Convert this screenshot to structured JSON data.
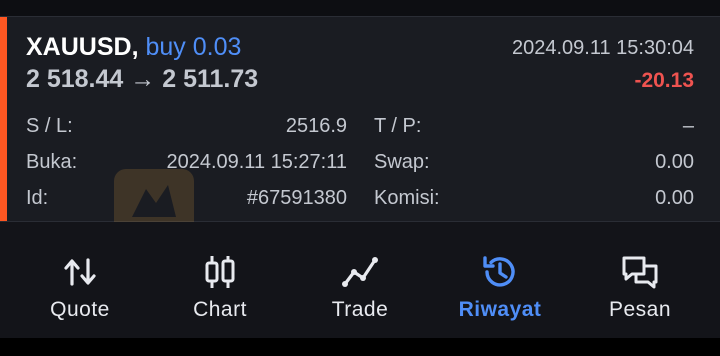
{
  "position": {
    "symbol": "XAUUSD,",
    "side_volume": "buy 0.03",
    "open_price": "2 518.44",
    "arrow": "→",
    "current_price": "2 511.73",
    "time": "2024.09.11 15:30:04",
    "profit": "-20.13",
    "profit_color": "#ef5350",
    "accent_color": "#ff5722"
  },
  "details": {
    "sl_label": "S / L:",
    "sl_value": "2516.9",
    "tp_label": "T / P:",
    "tp_value": "–",
    "open_label": "Buka:",
    "open_value": "2024.09.11 15:27:11",
    "swap_label": "Swap:",
    "swap_value": "0.00",
    "id_label": "Id:",
    "id_value": "#67591380",
    "commission_label": "Komisi:",
    "commission_value": "0.00"
  },
  "tabs": [
    {
      "label": "Quote",
      "icon": "quote-arrows-icon",
      "active": false
    },
    {
      "label": "Chart",
      "icon": "candlestick-chart-icon",
      "active": false
    },
    {
      "label": "Trade",
      "icon": "trade-line-icon",
      "active": false
    },
    {
      "label": "Riwayat",
      "icon": "history-clock-icon",
      "active": true
    },
    {
      "label": "Pesan",
      "icon": "messages-icon",
      "active": false
    }
  ],
  "colors": {
    "active_tab": "#4f8ef7",
    "background": "#1a1c22"
  }
}
